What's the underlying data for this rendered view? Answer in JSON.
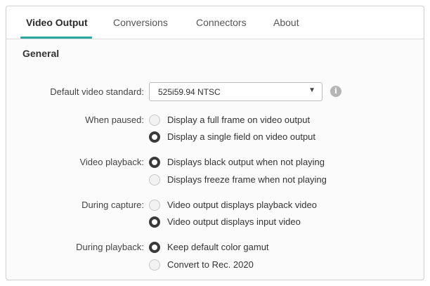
{
  "tabs": [
    {
      "label": "Video Output",
      "active": true
    },
    {
      "label": "Conversions",
      "active": false
    },
    {
      "label": "Connectors",
      "active": false
    },
    {
      "label": "About",
      "active": false
    }
  ],
  "colors": {
    "accent": "#2aa7a0"
  },
  "section_title": "General",
  "default_video_standard": {
    "label": "Default video standard:",
    "value": "525i59.94 NTSC",
    "arrow": "▼",
    "info_icon": "i"
  },
  "when_paused": {
    "label": "When paused:",
    "options": [
      {
        "label": "Display a full frame on video output",
        "selected": false
      },
      {
        "label": "Display a single field on video output",
        "selected": true
      }
    ]
  },
  "video_playback": {
    "label": "Video playback:",
    "options": [
      {
        "label": "Displays black output when not playing",
        "selected": true
      },
      {
        "label": "Displays freeze frame when not playing",
        "selected": false
      }
    ]
  },
  "during_capture": {
    "label": "During capture:",
    "options": [
      {
        "label": "Video output displays playback video",
        "selected": false
      },
      {
        "label": "Video output displays input video",
        "selected": true
      }
    ]
  },
  "during_playback": {
    "label": "During playback:",
    "options": [
      {
        "label": "Keep default color gamut",
        "selected": true
      },
      {
        "label": "Convert to Rec. 2020",
        "selected": false
      }
    ]
  }
}
